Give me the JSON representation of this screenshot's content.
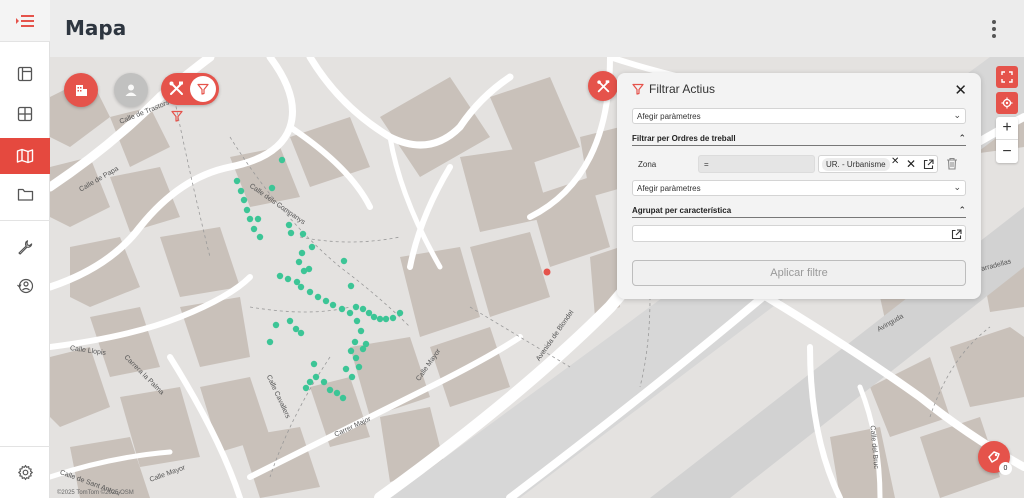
{
  "header": {
    "title": "Mapa"
  },
  "sidebar": {
    "items": [
      {
        "name": "menu",
        "icon": "menu-collapse-icon"
      },
      {
        "name": "layout",
        "icon": "layout-icon"
      },
      {
        "name": "grid",
        "icon": "grid-icon"
      },
      {
        "name": "map",
        "icon": "map-icon",
        "active": true
      },
      {
        "name": "folder",
        "icon": "folder-icon"
      },
      {
        "name": "tools",
        "icon": "wrench-icon"
      },
      {
        "name": "user-history",
        "icon": "user-clock-icon"
      },
      {
        "name": "settings",
        "icon": "gear-icon"
      }
    ]
  },
  "map": {
    "attribution": "©2025 TomTom ©2025 OSM",
    "notification_count": "0",
    "street_labels": [
      "Calle de Trastors",
      "Calle dels Companys",
      "Calle Llopis",
      "Carrera la Palma",
      "Calle Cavallers",
      "Carrer Major",
      "Calle Mayor",
      "Avenida de Blondel",
      "Avinguda",
      "Tarradellas",
      "Calle del Bruc",
      "Calle Mayor",
      "Calle de Sant Antoni",
      "Calle de Papa"
    ]
  },
  "filter_panel": {
    "title": "Filtrar Actius",
    "add_params_1": "Afegir paràmetres",
    "section_work_orders": "Filtrar per Ordres de treball",
    "row_label": "Zona",
    "operator": "=",
    "chip_value": "UR. - Urbanisme",
    "add_params_2": "Afegir paràmetres",
    "section_grouped": "Agrupat per característica",
    "grouped_value": "",
    "apply_button": "Aplicar filtre"
  },
  "colors": {
    "accent": "#e5534b",
    "points": "#3cc596"
  }
}
